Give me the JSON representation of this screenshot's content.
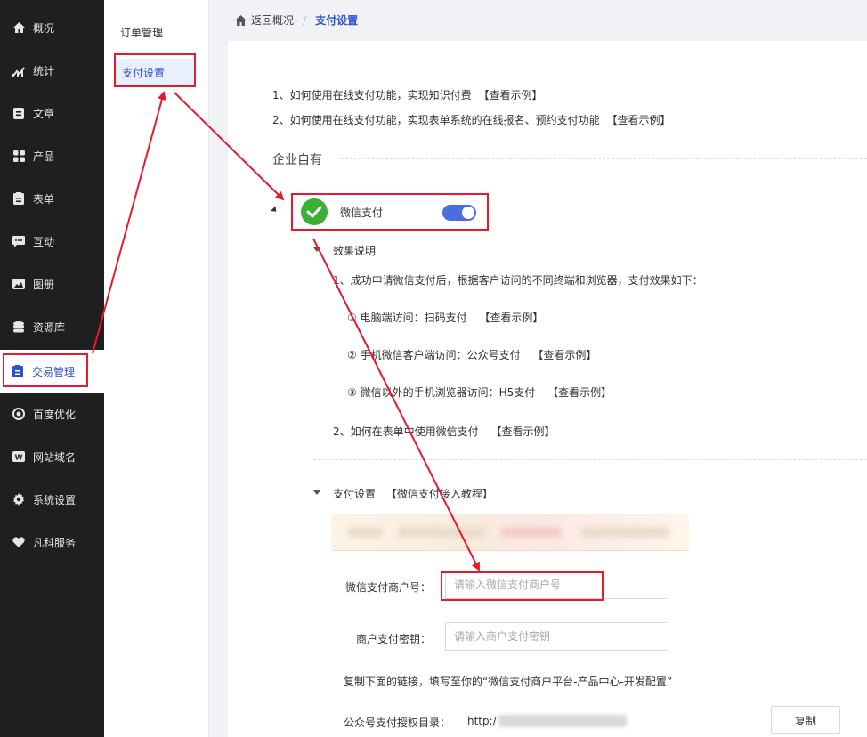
{
  "nav": {
    "items": [
      {
        "label": "概况",
        "icon": "home-icon"
      },
      {
        "label": "统计",
        "icon": "chart-icon"
      },
      {
        "label": "文章",
        "icon": "article-icon"
      },
      {
        "label": "产品",
        "icon": "product-icon"
      },
      {
        "label": "表单",
        "icon": "form-icon"
      },
      {
        "label": "互动",
        "icon": "chat-icon"
      },
      {
        "label": "图册",
        "icon": "album-icon"
      },
      {
        "label": "资源库",
        "icon": "database-icon"
      },
      {
        "label": "交易管理",
        "icon": "clipboard-icon"
      },
      {
        "label": "百度优化",
        "icon": "seo-icon"
      },
      {
        "label": "网站域名",
        "icon": "domain-icon"
      },
      {
        "label": "系统设置",
        "icon": "gear-icon"
      },
      {
        "label": "凡科服务",
        "icon": "heart-icon"
      }
    ]
  },
  "subnav": {
    "items": [
      {
        "label": "订单管理"
      },
      {
        "label": "支付设置"
      }
    ]
  },
  "breadcrumb": {
    "back": "返回概况",
    "sep": "/",
    "current": "支付设置"
  },
  "intro": {
    "line1": "1、如何使用在线支付功能，实现知识付费",
    "line1_link": "【查看示例】",
    "line2": "2、如何使用在线支付功能，实现表单系统的在线报名、预约支付功能",
    "line2_link": "【查看示例】"
  },
  "section_title": "企业自有",
  "wechat": {
    "label": "微信支付",
    "enabled": true
  },
  "effect": {
    "title": "效果说明",
    "line1": "1、成功申请微信支付后，根据客户访问的不同终端和浏览器，支付效果如下：",
    "item1": "① 电脑端访问：扫码支付",
    "item2": "② 手机微信客户端访问：公众号支付",
    "item3": "③ 微信以外的手机浏览器访问：H5支付",
    "line2": "2、如何在表单中使用微信支付",
    "link": "【查看示例】"
  },
  "pay_settings": {
    "title": "支付设置",
    "tutorial": "【微信支付接入教程】",
    "merchant_id_label": "微信支付商户号：",
    "merchant_id_placeholder": "请输入微信支付商户号",
    "merchant_key_label": "商户支付密钥：",
    "merchant_key_placeholder": "请输入商户支付密钥",
    "copy_hint": "复制下面的链接，填写至你的“微信支付商户平台-产品中心-开发配置”",
    "auth_dir_label": "公众号支付授权目录：",
    "auth_dir_value": "http:/",
    "copy_button": "复制"
  },
  "colors": {
    "accent": "#2d4ed6",
    "annotation": "#e8192c",
    "wechat_green": "#3cb034",
    "nav_bg": "#1f1f1f"
  }
}
